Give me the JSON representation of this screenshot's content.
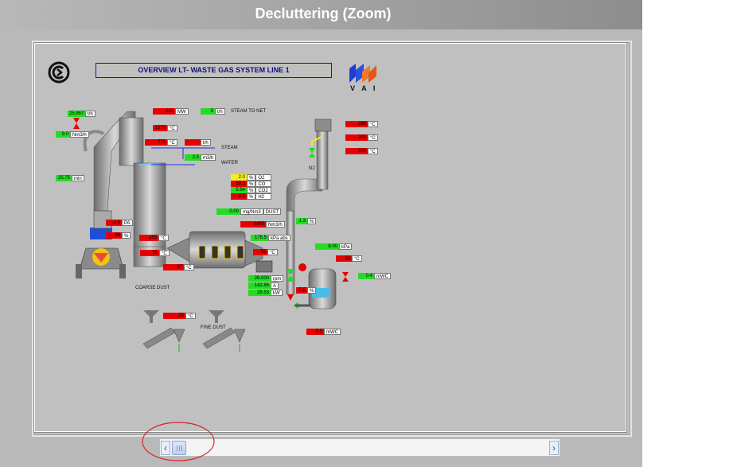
{
  "window": {
    "title": "Decluttering (Zoom)"
  },
  "page": {
    "title": "OVERVIEW LT- WASTE GAS  SYSTEM LINE 1",
    "vendor": "V A I"
  },
  "labels": {
    "steam_to_net": "STEAM TO NET",
    "steam": "STEAM",
    "water": "WATER",
    "n2": "N2",
    "coarse_dust": "COARSE DUST",
    "fine_dust": "FINE DUST"
  },
  "tags": [
    {
      "id": "t_steam_flow",
      "v": "25.867",
      "u": "t/h",
      "c": "g"
    },
    {
      "id": "t_gas_flow",
      "v": "9.0",
      "u": "Nm3/h",
      "c": "g"
    },
    {
      "id": "t_time",
      "v": "25.75",
      "u": "min",
      "c": "g"
    },
    {
      "id": "t_mw",
      "v": "230",
      "u": "MW",
      "c": "r"
    },
    {
      "id": "t_steam_net",
      "v": "5",
      "u": "t/h",
      "c": "g"
    },
    {
      "id": "t_temp1",
      "v": "1070",
      "u": "°C",
      "c": "r"
    },
    {
      "id": "t_temp2",
      "v": "772",
      "u": "°C",
      "c": "r"
    },
    {
      "id": "t_th2",
      "v": "",
      "u": "t/h",
      "c": "r"
    },
    {
      "id": "t_water",
      "v": "2.5",
      "u": "m3/h",
      "c": "g"
    },
    {
      "id": "t_pa",
      "v": "-1.0",
      "u": "PA",
      "c": "r"
    },
    {
      "id": "t_percent",
      "v": "96",
      "u": "%",
      "c": "r"
    },
    {
      "id": "t_temp3",
      "v": "150",
      "u": "°C",
      "c": "r"
    },
    {
      "id": "t_temp4",
      "v": "55",
      "u": "°C",
      "c": "r"
    },
    {
      "id": "t_temp5",
      "v": "67",
      "u": "°C",
      "c": "r"
    },
    {
      "id": "t_o2",
      "v": "2.0",
      "u": "%",
      "unit2": "O2",
      "c": "y"
    },
    {
      "id": "t_co",
      "v": "59.3",
      "u": "%",
      "unit2": "CO",
      "c": "r"
    },
    {
      "id": "t_co2",
      "v": "5.64",
      "u": "%",
      "unit2": "CO2",
      "c": "g"
    },
    {
      "id": "t_h2",
      "v": "4.0",
      "u": "%",
      "unit2": "H2",
      "c": "r"
    },
    {
      "id": "t_dust",
      "v": "0.00",
      "u": "mg/Nm3",
      "unit2": "DUST",
      "c": "g"
    },
    {
      "id": "t_flow2",
      "v": "4460",
      "u": "Nm3/h",
      "c": "r"
    },
    {
      "id": "t_pres",
      "v": "175.5",
      "u": "kPa abs",
      "c": "g"
    },
    {
      "id": "t_temp6",
      "v": "55",
      "u": "°C",
      "c": "r"
    },
    {
      "id": "t_rpm",
      "v": "26.000",
      "u": "rpm",
      "c": "g"
    },
    {
      "id": "t_amp",
      "v": "142.86",
      "u": "A",
      "c": "g"
    },
    {
      "id": "t_kw",
      "v": "28.53",
      "u": "kW",
      "c": "g"
    },
    {
      "id": "t_stack1",
      "v": "286",
      "u": "°C",
      "c": "r"
    },
    {
      "id": "t_stack2",
      "v": "200",
      "u": "°C",
      "c": "r"
    },
    {
      "id": "t_stack3",
      "v": "590",
      "u": "°C",
      "c": "r"
    },
    {
      "id": "t_kpa",
      "v": "8.00",
      "u": "kPa",
      "c": "g"
    },
    {
      "id": "t_temp7",
      "v": "32",
      "u": "°C",
      "c": "r"
    },
    {
      "id": "t_mwc1",
      "v": "0.4",
      "u": "mWC",
      "c": "g"
    },
    {
      "id": "t_mwc2",
      "v": "0.5",
      "u": "mWC",
      "c": "r"
    },
    {
      "id": "t_valve",
      "v": "1.3",
      "u": "%",
      "c": "g"
    },
    {
      "id": "t_fine",
      "v": "25",
      "u": "°C",
      "c": "r"
    },
    {
      "id": "t_pct2",
      "v": "5.5",
      "u": "%",
      "c": "r"
    }
  ]
}
